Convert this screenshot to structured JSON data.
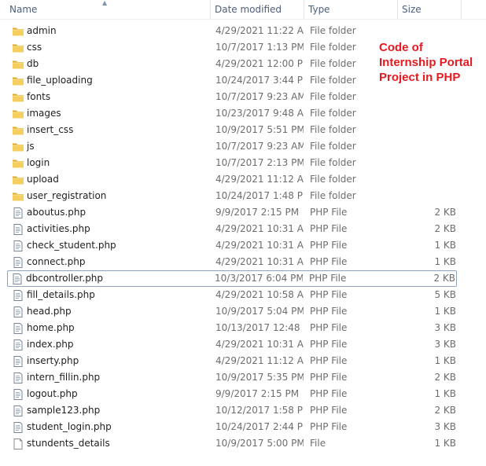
{
  "columns": {
    "name": "Name",
    "date_modified": "Date modified",
    "type": "Type",
    "size": "Size"
  },
  "annotation": {
    "line1": "Code of",
    "line2": "Internship Portal",
    "line3": "Project in PHP"
  },
  "colors": {
    "annotation": "#e8191e",
    "folder": "#f2c44a",
    "header_text": "#4c607a",
    "focus_border": "#8ea3c0"
  },
  "files": [
    {
      "name": "admin",
      "date": "4/29/2021 11:22 AM",
      "type": "File folder",
      "size": "",
      "icon": "folder-icon"
    },
    {
      "name": "css",
      "date": "10/7/2017 1:13 PM",
      "type": "File folder",
      "size": "",
      "icon": "folder-icon"
    },
    {
      "name": "db",
      "date": "4/29/2021 12:00 PM",
      "type": "File folder",
      "size": "",
      "icon": "folder-icon"
    },
    {
      "name": "file_uploading",
      "date": "10/24/2017 3:44 PM",
      "type": "File folder",
      "size": "",
      "icon": "folder-icon"
    },
    {
      "name": "fonts",
      "date": "10/7/2017 9:23 AM",
      "type": "File folder",
      "size": "",
      "icon": "folder-icon"
    },
    {
      "name": "images",
      "date": "10/23/2017 9:48 AM",
      "type": "File folder",
      "size": "",
      "icon": "folder-icon"
    },
    {
      "name": "insert_css",
      "date": "10/9/2017 5:51 PM",
      "type": "File folder",
      "size": "",
      "icon": "folder-icon"
    },
    {
      "name": "js",
      "date": "10/7/2017 9:23 AM",
      "type": "File folder",
      "size": "",
      "icon": "folder-icon"
    },
    {
      "name": "login",
      "date": "10/7/2017 2:13 PM",
      "type": "File folder",
      "size": "",
      "icon": "folder-icon"
    },
    {
      "name": "upload",
      "date": "4/29/2021 11:12 AM",
      "type": "File folder",
      "size": "",
      "icon": "folder-icon"
    },
    {
      "name": "user_registration",
      "date": "10/24/2017 1:48 PM",
      "type": "File folder",
      "size": "",
      "icon": "folder-icon"
    },
    {
      "name": "aboutus.php",
      "date": "9/9/2017 2:15 PM",
      "type": "PHP File",
      "size": "2 KB",
      "icon": "php-file-icon"
    },
    {
      "name": "activities.php",
      "date": "4/29/2021 10:31 AM",
      "type": "PHP File",
      "size": "2 KB",
      "icon": "php-file-icon"
    },
    {
      "name": "check_student.php",
      "date": "4/29/2021 10:31 AM",
      "type": "PHP File",
      "size": "1 KB",
      "icon": "php-file-icon"
    },
    {
      "name": "connect.php",
      "date": "4/29/2021 10:31 AM",
      "type": "PHP File",
      "size": "1 KB",
      "icon": "php-file-icon"
    },
    {
      "name": "dbcontroller.php",
      "date": "10/3/2017 6:04 PM",
      "type": "PHP File",
      "size": "2 KB",
      "icon": "php-file-icon",
      "focused": true
    },
    {
      "name": "fill_details.php",
      "date": "4/29/2021 10:58 AM",
      "type": "PHP File",
      "size": "5 KB",
      "icon": "php-file-icon"
    },
    {
      "name": "head.php",
      "date": "10/9/2017 5:04 PM",
      "type": "PHP File",
      "size": "1 KB",
      "icon": "php-file-icon"
    },
    {
      "name": "home.php",
      "date": "10/13/2017 12:48 ...",
      "type": "PHP File",
      "size": "3 KB",
      "icon": "php-file-icon"
    },
    {
      "name": "index.php",
      "date": "4/29/2021 10:31 AM",
      "type": "PHP File",
      "size": "3 KB",
      "icon": "php-file-icon"
    },
    {
      "name": "inserty.php",
      "date": "4/29/2021 11:12 AM",
      "type": "PHP File",
      "size": "1 KB",
      "icon": "php-file-icon"
    },
    {
      "name": "intern_fillin.php",
      "date": "10/9/2017 5:35 PM",
      "type": "PHP File",
      "size": "2 KB",
      "icon": "php-file-icon"
    },
    {
      "name": "logout.php",
      "date": "9/9/2017 2:15 PM",
      "type": "PHP File",
      "size": "1 KB",
      "icon": "php-file-icon"
    },
    {
      "name": "sample123.php",
      "date": "10/12/2017 1:58 PM",
      "type": "PHP File",
      "size": "2 KB",
      "icon": "php-file-icon"
    },
    {
      "name": "student_login.php",
      "date": "10/24/2017 2:44 PM",
      "type": "PHP File",
      "size": "3 KB",
      "icon": "php-file-icon"
    },
    {
      "name": "stundents_details",
      "date": "10/9/2017 5:00 PM",
      "type": "File",
      "size": "1 KB",
      "icon": "file-icon"
    }
  ]
}
